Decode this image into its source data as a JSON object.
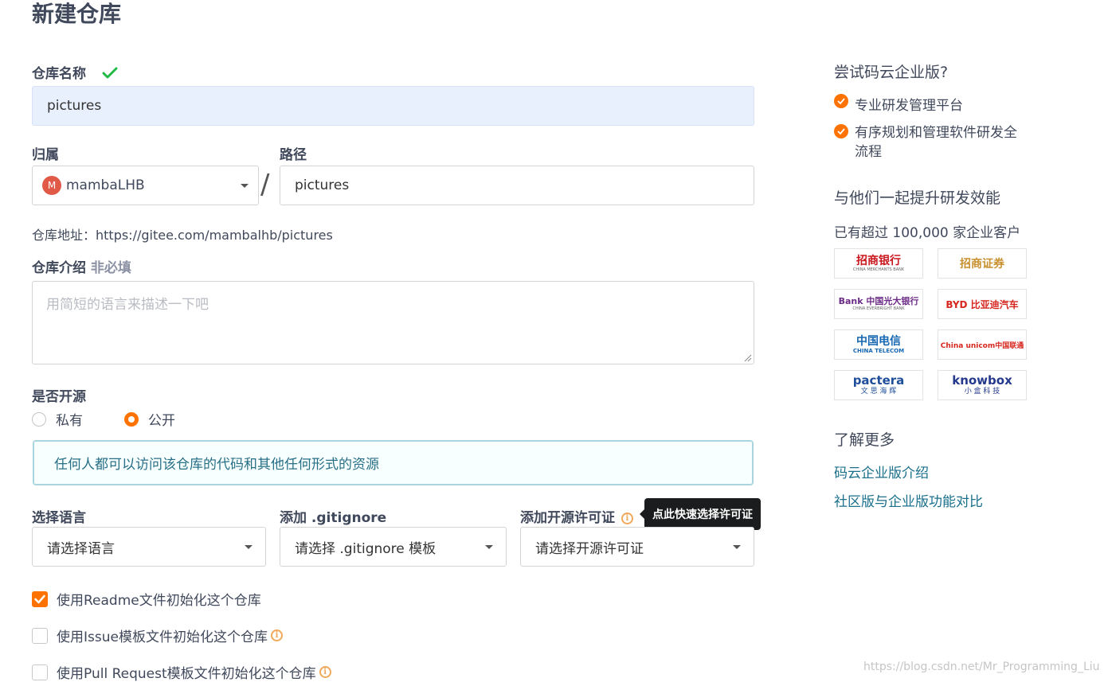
{
  "page": {
    "title": "新建仓库"
  },
  "form": {
    "repo_name": {
      "label": "仓库名称",
      "value": "pictures"
    },
    "owner": {
      "label": "归属",
      "avatar_letter": "M",
      "value": "mambaLHB"
    },
    "separator": "/",
    "path": {
      "label": "路径",
      "value": "pictures"
    },
    "repo_url": "仓库地址：https://gitee.com/mambalhb/pictures",
    "description": {
      "label": "仓库介绍",
      "optional_tag": "非必填",
      "placeholder": "用简短的语言来描述一下吧"
    },
    "visibility": {
      "label": "是否开源",
      "options": [
        {
          "label": "私有",
          "checked": false
        },
        {
          "label": "公开",
          "checked": true
        }
      ],
      "notice": "任何人都可以访问该仓库的代码和其他任何形式的资源"
    },
    "language": {
      "label": "选择语言",
      "value": "请选择语言"
    },
    "gitignore": {
      "label": "添加 .gitignore",
      "value": "请选择 .gitignore 模板"
    },
    "license": {
      "label": "添加开源许可证",
      "value": "请选择开源许可证",
      "tooltip": "点此快速选择许可证"
    },
    "init_options": [
      {
        "label": "使用Readme文件初始化这个仓库",
        "checked": true,
        "has_info": false
      },
      {
        "label": "使用Issue模板文件初始化这个仓库",
        "checked": false,
        "has_info": true
      },
      {
        "label": "使用Pull Request模板文件初始化这个仓库",
        "checked": false,
        "has_info": true
      }
    ]
  },
  "sidebar": {
    "try_title": "尝试码云企业版?",
    "features": [
      "专业研发管理平台",
      "有序规划和管理软件研发全流程"
    ],
    "together_title": "与他们一起提升研发效能",
    "customers_text": "已有超过 100,000 家企业客户",
    "logos": [
      {
        "main": "招商银行",
        "sub": "CHINA MERCHANTS BANK",
        "color": "#c8161d"
      },
      {
        "main": "招商证券",
        "sub": "",
        "color": "#c8902e"
      },
      {
        "main": "Bank 中国光大银行",
        "sub": "CHINA EVERBRIGHT BANK",
        "color": "#6b2b86"
      },
      {
        "main": "BYD 比亚迪汽车",
        "sub": "",
        "color": "#d7261e"
      },
      {
        "main": "中国电信",
        "sub": "CHINA TELECOM",
        "color": "#1768b2"
      },
      {
        "main": "China unicom中国联通",
        "sub": "",
        "color": "#d7261e"
      },
      {
        "main": "pactera",
        "sub": "文 思 海 辉",
        "color": "#1f4e9b"
      },
      {
        "main": "knowbox",
        "sub": "小 盒 科 技",
        "color": "#24388c"
      }
    ],
    "learn_more_title": "了解更多",
    "links": [
      "码云企业版介绍",
      "社区版与企业版功能对比"
    ]
  },
  "watermark": "https://blog.csdn.net/Mr_Programming_Liu",
  "colors": {
    "accent": "#fe7300",
    "link": "#1a6f8b",
    "success": "#21ba45",
    "info": "#f0a95b"
  }
}
